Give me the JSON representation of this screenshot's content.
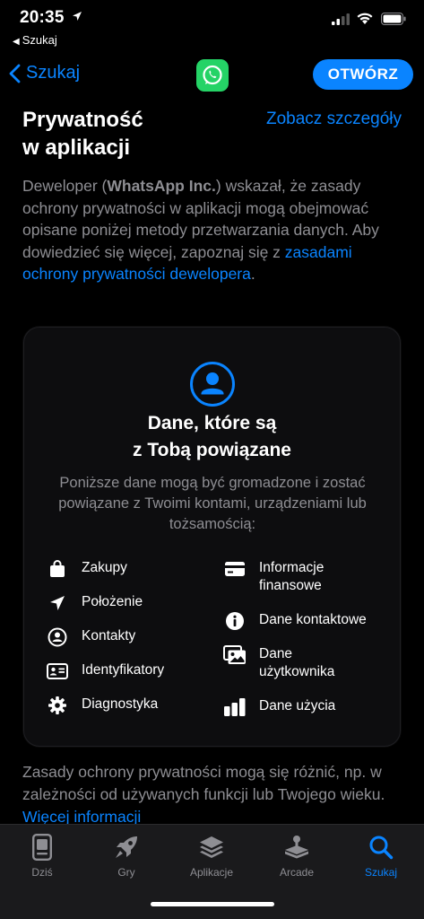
{
  "status_bar": {
    "time": "20:35",
    "back_app": "Szukaj"
  },
  "nav": {
    "back_label": "Szukaj",
    "open_button": "OTWÓRZ",
    "app_icon": "whatsapp-icon",
    "app_icon_color": "#25d366",
    "accent_color": "#0a84ff"
  },
  "privacy": {
    "title_line1": "Prywatność",
    "title_line2": "w aplikacji",
    "see_details": "Zobacz szczegóły",
    "desc_prefix": "Deweloper (",
    "developer": "WhatsApp Inc.",
    "desc_middle": ") wskazał, że zasady ochrony prywatności w aplikacji mogą obejmować opisane poniżej metody przetwarzania danych. Aby dowiedzieć się więcej, zapoznaj się z ",
    "desc_link": "zasadami ochrony prywatności dewelopera",
    "desc_suffix": "."
  },
  "card": {
    "icon": "person-circle-icon",
    "title_line1": "Dane, które są",
    "title_line2": "z Tobą powiązane",
    "subtitle": "Poniższe dane mogą być gromadzone i zostać powiązane z Twoimi kontami, urządzeniami lub tożsamością:",
    "left_items": [
      {
        "icon": "shopping-bag-icon",
        "label": "Zakupy"
      },
      {
        "icon": "location-arrow-icon",
        "label": "Położenie"
      },
      {
        "icon": "contact-circle-icon",
        "label": "Kontakty"
      },
      {
        "icon": "id-card-icon",
        "label": "Identyfikatory"
      },
      {
        "icon": "gear-icon",
        "label": "Diagnostyka"
      }
    ],
    "right_items": [
      {
        "icon": "credit-card-icon",
        "label_line1": "Informacje",
        "label_line2": "finansowe"
      },
      {
        "icon": "info-icon",
        "label_line1": "Dane kontaktowe",
        "label_line2": ""
      },
      {
        "icon": "photos-icon",
        "label_line1": "Dane",
        "label_line2": "użytkownika"
      },
      {
        "icon": "bar-chart-icon",
        "label_line1": "Dane użycia",
        "label_line2": ""
      }
    ]
  },
  "footer": {
    "text": "Zasady ochrony prywatności mogą się różnić, np. w zależności od używanych funkcji lub Twojego wieku. ",
    "link": "Więcej informacji"
  },
  "tabbar": {
    "tabs": [
      {
        "icon": "today-icon",
        "label": "Dziś"
      },
      {
        "icon": "rocket-icon",
        "label": "Gry"
      },
      {
        "icon": "layers-icon",
        "label": "Aplikacje"
      },
      {
        "icon": "arcade-icon",
        "label": "Arcade"
      },
      {
        "icon": "search-icon",
        "label": "Szukaj"
      }
    ],
    "active": "Szukaj"
  }
}
